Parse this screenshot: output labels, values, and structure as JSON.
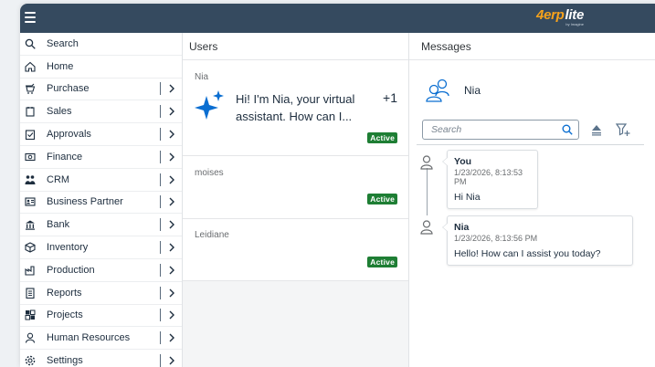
{
  "brand": {
    "logo_number": "4",
    "logo_erp": "erp",
    "logo_lite": "lite",
    "logo_sub": "by Imagine",
    "topbar_color": "#354a5f",
    "accent_color": "#f7a21b"
  },
  "sidebar": {
    "items": [
      {
        "label": "Search",
        "icon": "search-icon",
        "has_arrow": false
      },
      {
        "label": "Home",
        "icon": "home-icon",
        "has_arrow": false
      },
      {
        "label": "Purchase",
        "icon": "purchase-icon",
        "has_arrow": true
      },
      {
        "label": "Sales",
        "icon": "sales-icon",
        "has_arrow": true
      },
      {
        "label": "Approvals",
        "icon": "approvals-icon",
        "has_arrow": true
      },
      {
        "label": "Finance",
        "icon": "finance-icon",
        "has_arrow": true
      },
      {
        "label": "CRM",
        "icon": "crm-icon",
        "has_arrow": true
      },
      {
        "label": "Business Partner",
        "icon": "business-partner-icon",
        "has_arrow": true
      },
      {
        "label": "Bank",
        "icon": "bank-icon",
        "has_arrow": true
      },
      {
        "label": "Inventory",
        "icon": "inventory-icon",
        "has_arrow": true
      },
      {
        "label": "Production",
        "icon": "production-icon",
        "has_arrow": true
      },
      {
        "label": "Reports",
        "icon": "reports-icon",
        "has_arrow": true
      },
      {
        "label": "Projects",
        "icon": "projects-icon",
        "has_arrow": true
      },
      {
        "label": "Human Resources",
        "icon": "human-resources-icon",
        "has_arrow": true
      },
      {
        "label": "Settings",
        "icon": "settings-icon",
        "has_arrow": true
      }
    ]
  },
  "users_panel": {
    "title": "Users",
    "users": [
      {
        "name": "Nia",
        "preview": "Hi! I'm Nia, your virtual assistant. How can I...",
        "unread": "+1",
        "status": "Active"
      },
      {
        "name": "moises",
        "status": "Active"
      },
      {
        "name": "Leidiane",
        "status": "Active"
      }
    ]
  },
  "messages_panel": {
    "title": "Messages",
    "contact_name": "Nia",
    "search_placeholder": "Search",
    "messages": [
      {
        "sender": "You",
        "time": "1/23/2026, 8:13:53 PM",
        "text": "Hi Nia"
      },
      {
        "sender": "Nia",
        "time": "1/23/2026, 8:13:56 PM",
        "text": "Hello! How can I assist you today?"
      }
    ]
  },
  "colors": {
    "status_active": "#1e7e34",
    "sparkle": "#0a6ed1"
  }
}
